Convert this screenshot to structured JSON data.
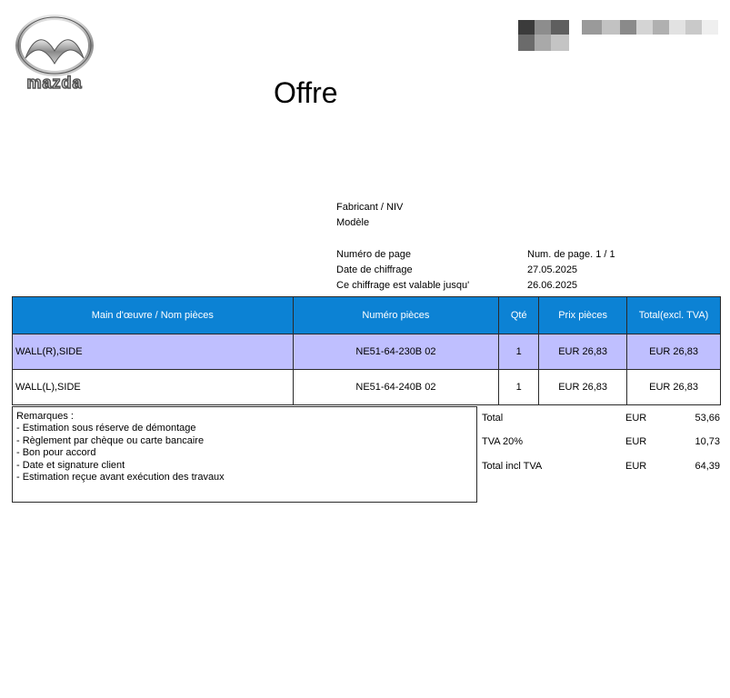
{
  "header": {
    "title": "Offre"
  },
  "info": [
    {
      "label": "Fabricant / NIV",
      "value": ""
    },
    {
      "label": "Modèle",
      "value": ""
    },
    {
      "label": "Numéro de page",
      "value": "Num. de page. 1 / 1"
    },
    {
      "label": "Date de chiffrage",
      "value": "27.05.2025"
    },
    {
      "label": "Ce chiffrage est valable jusqu'",
      "value": "26.06.2025"
    }
  ],
  "table": {
    "headers": [
      "Main d'œuvre / Nom pièces",
      "Numéro pièces",
      "Qté",
      "Prix pièces",
      "Total(excl. TVA)"
    ],
    "rows": [
      {
        "name": "WALL(R),SIDE",
        "part": "NE51-64-230B 02",
        "qty": "1",
        "price": "EUR 26,83",
        "total": "EUR 26,83"
      },
      {
        "name": "WALL(L),SIDE",
        "part": "NE51-64-240B 02",
        "qty": "1",
        "price": "EUR 26,83",
        "total": "EUR 26,83"
      }
    ]
  },
  "remarks": {
    "title": "Remarques :",
    "lines": [
      "- Estimation sous réserve de démontage",
      "- Règlement par chèque ou carte bancaire",
      "- Bon pour accord",
      "- Date et signature client",
      "- Estimation reçue avant exécution des travaux"
    ]
  },
  "totals": [
    {
      "label": "Total",
      "currency": "EUR",
      "amount": "53,66"
    },
    {
      "label": "TVA 20%",
      "currency": "EUR",
      "amount": "10,73"
    },
    {
      "label": "Total incl TVA",
      "currency": "EUR",
      "amount": "64,39"
    }
  ],
  "logo": {
    "wordmark": "mazda",
    "icon": "mazda-logo-icon"
  },
  "colors": {
    "header_blue": "#0c82d4",
    "highlight_row": "#bfbfff"
  }
}
